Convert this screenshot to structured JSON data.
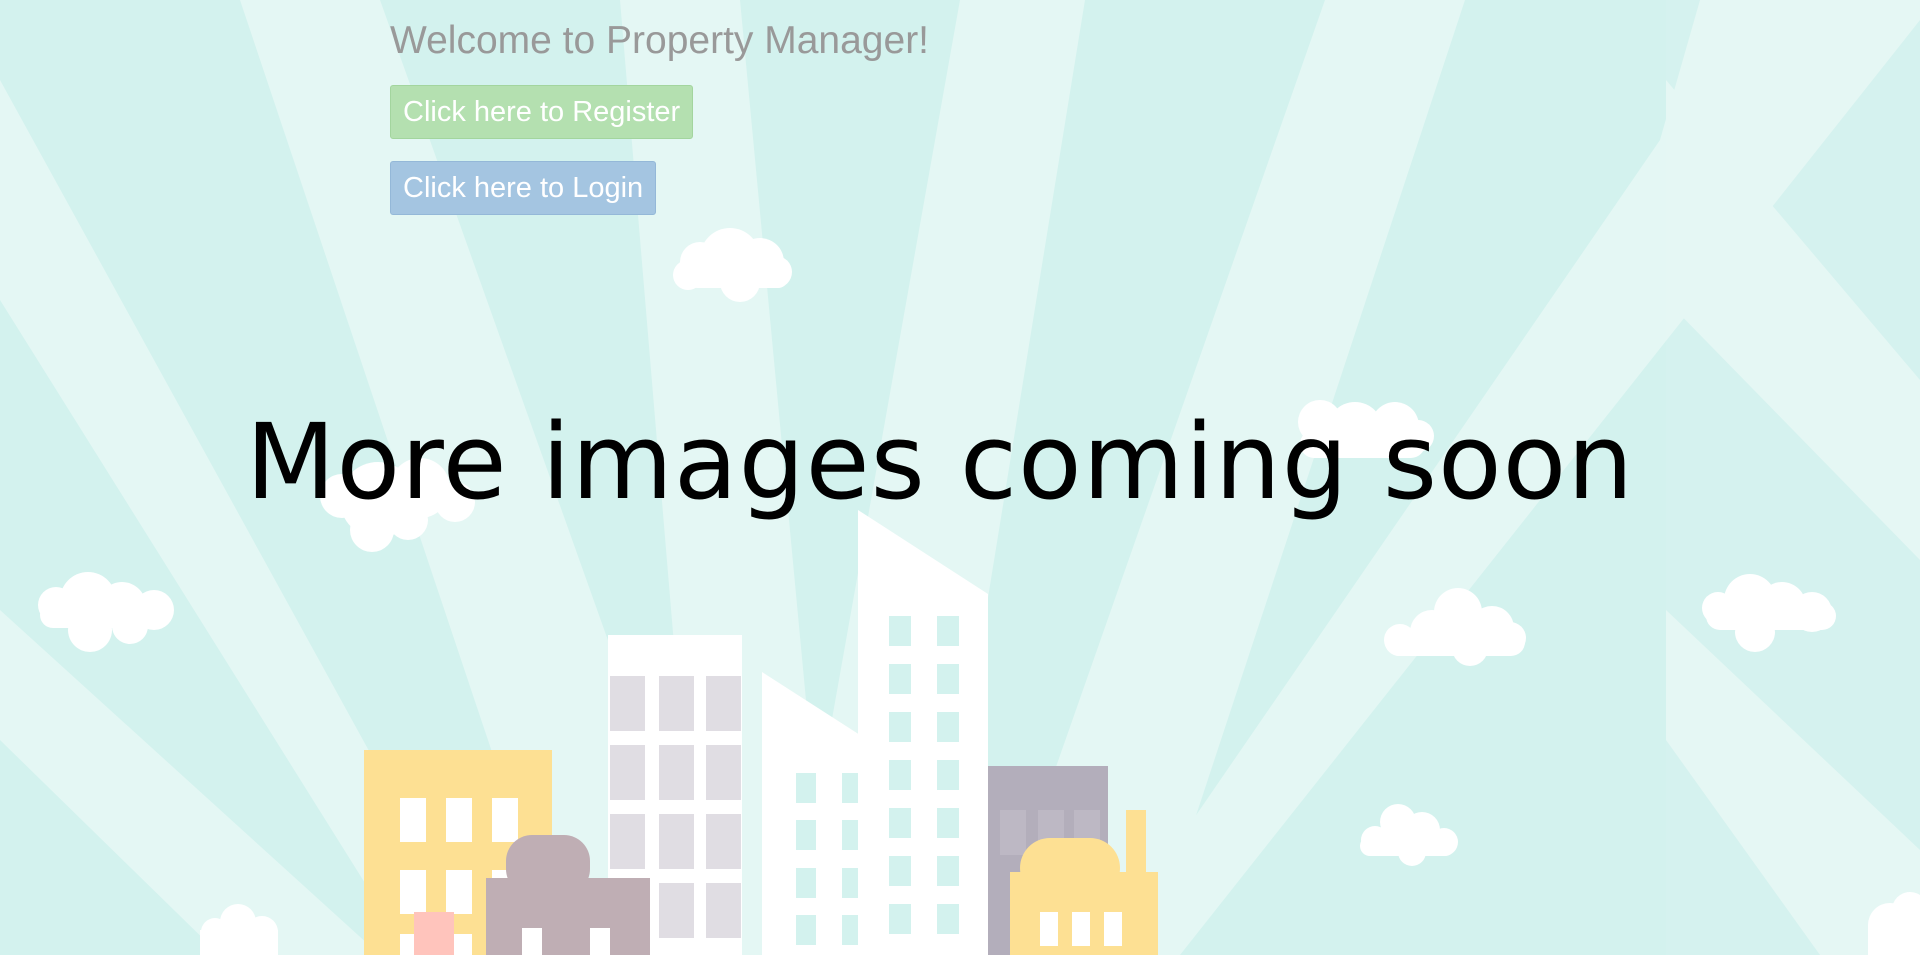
{
  "header": {
    "welcome_text": "Welcome to Property Manager!"
  },
  "actions": {
    "register_label": "Click here to Register",
    "login_label": "Click here to Login"
  },
  "main": {
    "coming_soon_text": "More images coming soon"
  },
  "colors": {
    "background": "#d3f2ee",
    "rays": "#e4f7f4",
    "register_button": "#b4e0b0",
    "login_button": "#a4c5e1",
    "building_yellow": "#fde093",
    "building_mauve": "#bfaeb4",
    "building_gray": "#b3aebb",
    "building_white": "#ffffff",
    "window_lavender": "#e0dde3",
    "window_teal": "#d3f2ee",
    "door_pink": "#ffc4bc"
  }
}
